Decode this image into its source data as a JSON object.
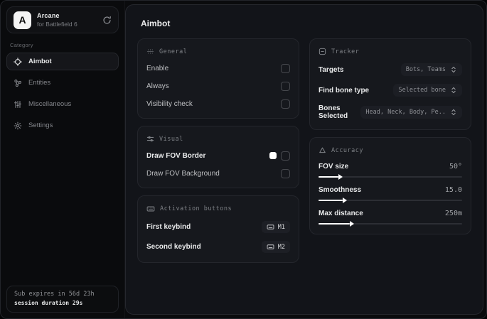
{
  "app": {
    "logo_letter": "A",
    "name": "Arcane",
    "subtitle": "for Battlefield 6"
  },
  "sidebar": {
    "category_label": "Category",
    "items": [
      {
        "label": "Aimbot"
      },
      {
        "label": "Entities"
      },
      {
        "label": "Miscellaneous"
      },
      {
        "label": "Settings"
      }
    ],
    "subscription": {
      "expires": "Sub expires in 56d 23h",
      "session": "session duration 29s"
    }
  },
  "main": {
    "title": "Aimbot",
    "general": {
      "title": "General",
      "rows": [
        {
          "label": "Enable",
          "checked": false
        },
        {
          "label": "Always",
          "checked": false
        },
        {
          "label": "Visibility check",
          "checked": false
        }
      ]
    },
    "visual": {
      "title": "Visual",
      "rows": [
        {
          "label": "Draw FOV Border",
          "swatch": "#ffffff",
          "checked": false
        },
        {
          "label": "Draw FOV Background",
          "checked": false
        }
      ]
    },
    "activation": {
      "title": "Activation buttons",
      "rows": [
        {
          "label": "First keybind",
          "key": "M1"
        },
        {
          "label": "Second keybind",
          "key": "M2"
        }
      ]
    },
    "tracker": {
      "title": "Tracker",
      "rows": [
        {
          "label": "Targets",
          "value": "Bots, Teams"
        },
        {
          "label": "Find bone type",
          "value": "Selected bone"
        },
        {
          "label": "Bones Selected",
          "value": "Head, Neck, Body, Pe.."
        }
      ]
    },
    "accuracy": {
      "title": "Accuracy",
      "rows": [
        {
          "label": "FOV size",
          "value": "50°",
          "fill_pct": 14
        },
        {
          "label": "Smoothness",
          "value": "15.0",
          "fill_pct": 17
        },
        {
          "label": "Max distance",
          "value": "250m",
          "fill_pct": 22
        }
      ]
    },
    "colors": {
      "accent": "#ffffff",
      "panel": "#121419",
      "card": "#16181d"
    }
  }
}
